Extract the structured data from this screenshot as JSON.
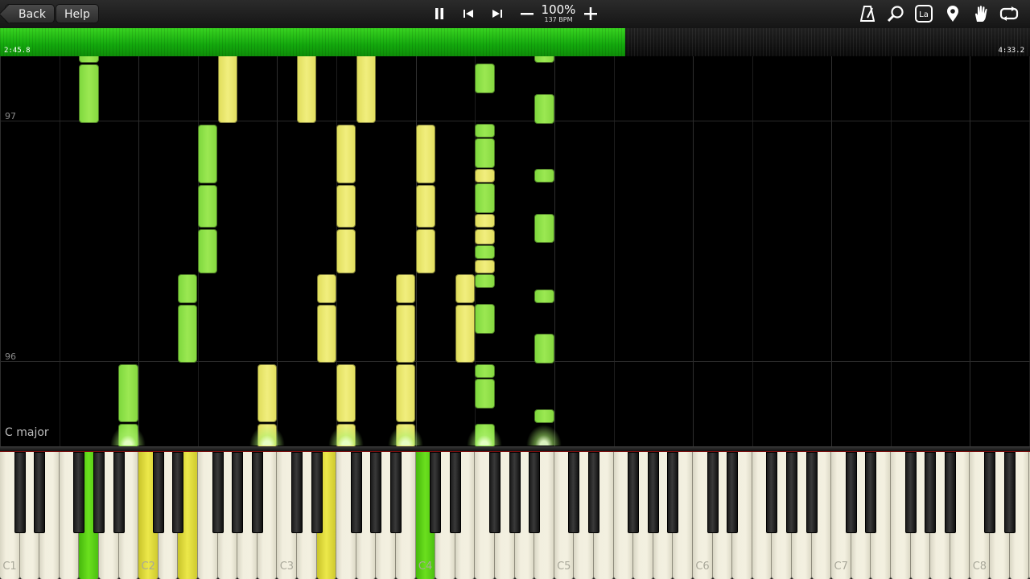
{
  "toolbar": {
    "back_label": "Back",
    "help_label": "Help",
    "speed_percent": "100%",
    "bpm_label": "137 BPM"
  },
  "icons": {
    "pause": "pause-icon",
    "prev": "skip-back-icon",
    "next": "skip-forward-icon",
    "minus": "minus-icon",
    "plus": "plus-icon",
    "metronome": "metronome-icon",
    "zoom": "magnifier-icon",
    "note_labels": "note-labels-icon",
    "marker": "location-pin-icon",
    "hand": "hand-icon",
    "loop": "loop-icon"
  },
  "note_labels_icon_text": "La",
  "progress": {
    "elapsed": "2:45.8",
    "total": "4:33.2",
    "fraction": 0.607
  },
  "colors": {
    "green_note": "#9be852",
    "yellow_note": "#f1ee7e",
    "progress_green": "#13a80d"
  },
  "roll": {
    "measure_upper": "97",
    "measure_lower": "96",
    "key_signature": "C major"
  },
  "keyboard": {
    "octave_labels": [
      "C1",
      "C2",
      "C3",
      "C4",
      "C5",
      "C6",
      "C7",
      "C8"
    ],
    "pressed_green": [
      "G1",
      "C4"
    ],
    "pressed_yellow": [
      "C2",
      "E3",
      "E2"
    ]
  }
}
